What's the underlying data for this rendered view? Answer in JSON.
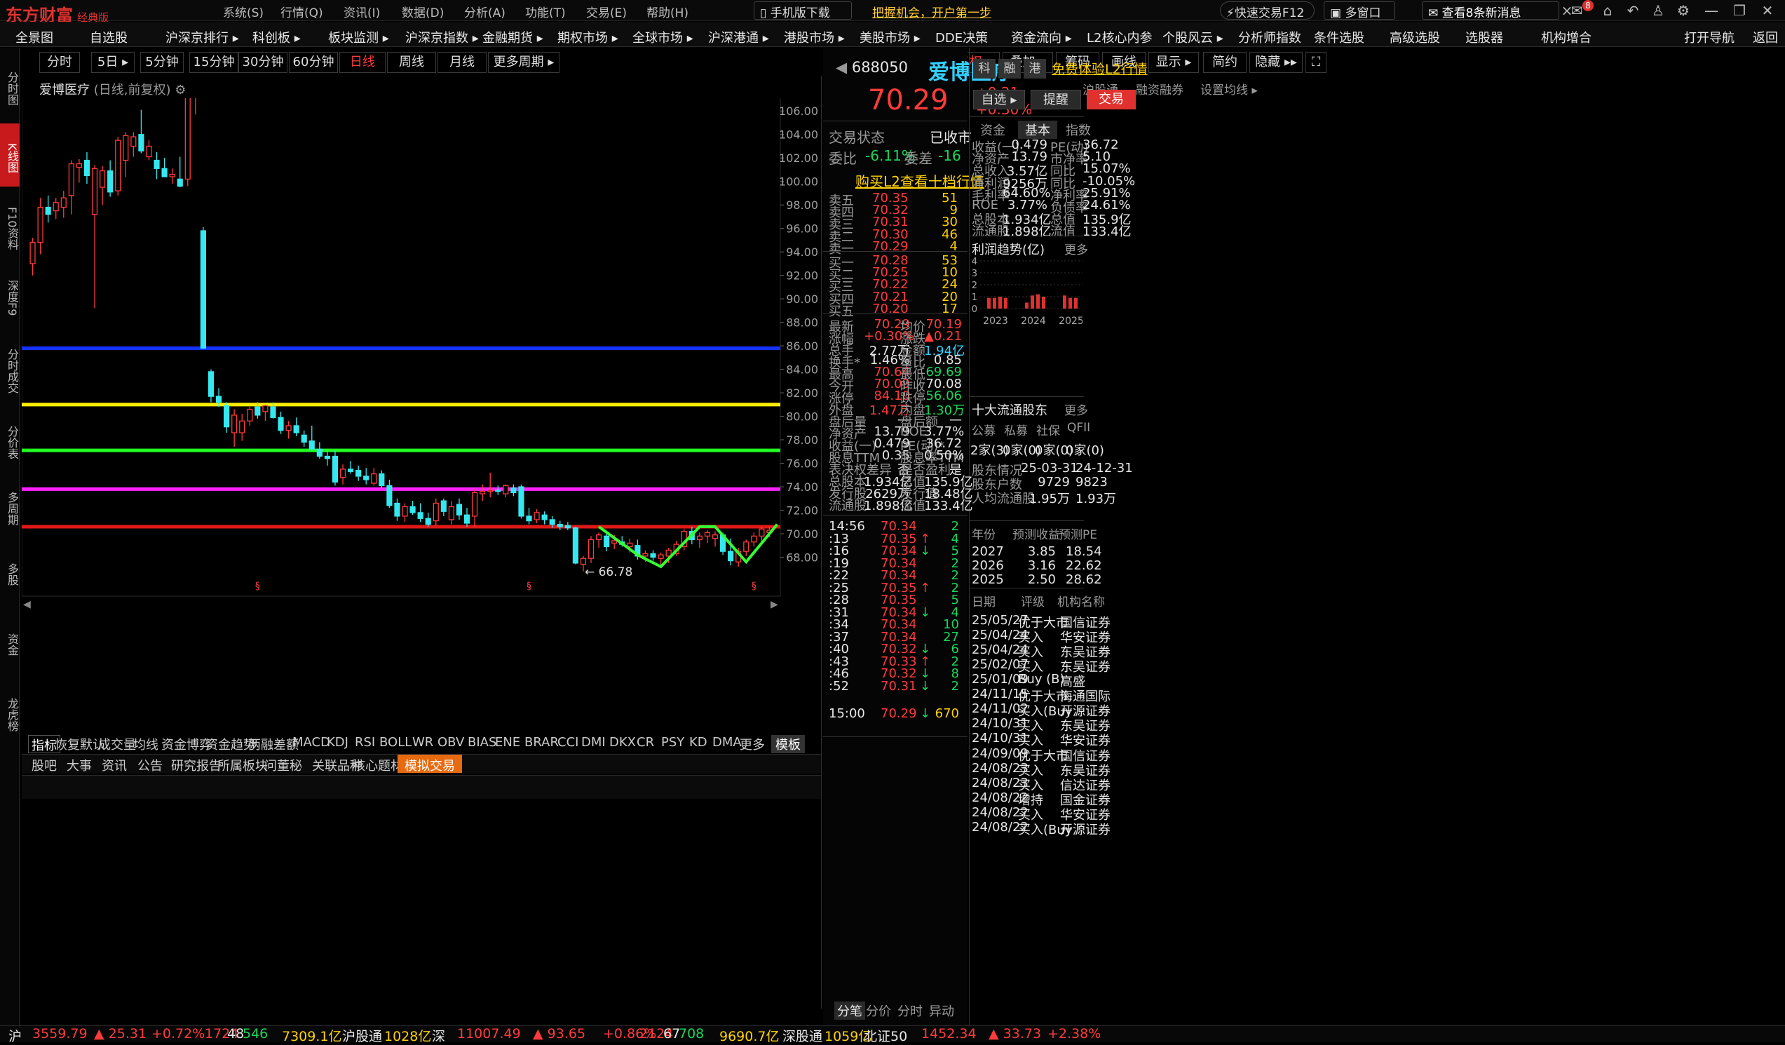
{
  "app": {
    "logo": "东方财富",
    "edition": "经典版"
  },
  "title_menu": [
    "系统(S)",
    "行情(Q)",
    "资讯(I)",
    "数据(D)",
    "分析(A)",
    "功能(T)",
    "交易(E)",
    "帮助(H)"
  ],
  "title_buttons": {
    "mobile": "手机版下载",
    "promo": "把握机会，开户第一步",
    "quick_trade": "快速交易F12",
    "multi_window": "多窗口",
    "messages": "查看8条新消息",
    "badge": "8"
  },
  "nav": [
    "全景图",
    "自选股",
    "沪深京排行 ▸",
    "科创板 ▸",
    "板块监测 ▸",
    "沪深京指数 ▸",
    "金融期货 ▸",
    "期权市场 ▸",
    "全球市场 ▸",
    "沪深港通 ▸",
    "港股市场 ▸",
    "美股市场 ▸",
    "DDE决策",
    "资金流向 ▸",
    "L2核心内参",
    "个股风云 ▸",
    "分析师指数",
    "条件选股",
    "高级选股",
    "选股器",
    "机构增合",
    "打开导航",
    "返回"
  ],
  "left_tabs": [
    "分时图",
    "K线图",
    "F10资料",
    "深度F9",
    "分时成交",
    "分价表",
    "多周期",
    "多股",
    "资金",
    "龙虎榜"
  ],
  "periods": [
    "分时",
    "5日 ▸",
    "5分钟",
    "15分钟",
    "30分钟",
    "60分钟",
    "日线",
    "周线",
    "月线",
    "更多周期 ▸"
  ],
  "chart_tools": [
    "+",
    "−",
    "复权 ▸",
    "叠加 ▸",
    "筹码",
    "画线",
    "显示 ▸",
    "简约",
    "隐藏 ▸▸"
  ],
  "chart_header": {
    "name": "爱博医疗",
    "mode": "(日线,前复权)",
    "links": [
      "沪股通",
      "融资融券",
      "设置均线 ▸"
    ]
  },
  "chart_data": {
    "type": "candlestick",
    "ylim": [
      66.0,
      109.0
    ],
    "yticks": [
      "108.00",
      "106.00",
      "104.00",
      "102.00",
      "100.00",
      "98.00",
      "96.00",
      "94.00",
      "92.00",
      "90.00",
      "88.00",
      "86.00",
      "84.00",
      "82.00",
      "80.00",
      "78.00",
      "76.00",
      "74.00",
      "72.00",
      "70.00",
      "68.00"
    ],
    "high_label": "108.09",
    "low_label": "66.78",
    "hlines": [
      {
        "value": 85.8,
        "color": "#1632ff"
      },
      {
        "value": 81.0,
        "color": "#ffee00"
      },
      {
        "value": 77.1,
        "color": "#22ff22"
      },
      {
        "value": 73.8,
        "color": "#ff22ff"
      },
      {
        "value": 70.6,
        "color": "#e01818"
      }
    ],
    "candles": [
      [
        93.0,
        95.2,
        92.0,
        94.8
      ],
      [
        94.8,
        98.6,
        93.8,
        97.8
      ],
      [
        97.8,
        98.8,
        96.5,
        97.2
      ],
      [
        97.5,
        98.6,
        96.8,
        98.2
      ],
      [
        97.8,
        99.2,
        96.9,
        98.6
      ],
      [
        98.8,
        101.8,
        97.2,
        101.5
      ],
      [
        101.2,
        101.9,
        99.9,
        101.5
      ],
      [
        101.8,
        102.5,
        99.8,
        100.5
      ],
      [
        97.2,
        101.4,
        89.2,
        101.1
      ],
      [
        99.5,
        101.3,
        98.0,
        100.9
      ],
      [
        100.9,
        101.8,
        98.7,
        99.1
      ],
      [
        99.2,
        103.8,
        98.8,
        103.5
      ],
      [
        101.8,
        104.2,
        100.4,
        103.9
      ],
      [
        103.0,
        104.2,
        102.1,
        103.8
      ],
      [
        104.0,
        106.1,
        102.4,
        102.6
      ],
      [
        102.1,
        103.5,
        101.8,
        103.0
      ],
      [
        101.8,
        102.5,
        100.2,
        101.1
      ],
      [
        101.1,
        102.0,
        100.6,
        100.4
      ],
      [
        100.4,
        101.1,
        99.8,
        100.6
      ],
      [
        100.2,
        102.1,
        99.5,
        99.6
      ],
      [
        100.2,
        108.1,
        99.6,
        107.6
      ],
      [
        107.2,
        107.8,
        105.7,
        107.5
      ],
      [
        95.8,
        96.1,
        85.8,
        85.8
      ],
      [
        83.8,
        84.0,
        81.2,
        81.7
      ],
      [
        81.7,
        82.4,
        80.8,
        81.2
      ],
      [
        80.9,
        81.2,
        78.6,
        79.1
      ],
      [
        78.6,
        80.6,
        77.4,
        80.1
      ],
      [
        78.6,
        80.2,
        77.9,
        79.6
      ],
      [
        79.6,
        80.9,
        79.2,
        80.6
      ],
      [
        80.8,
        81.2,
        79.8,
        80.1
      ],
      [
        80.4,
        81.0,
        79.6,
        80.9
      ],
      [
        80.8,
        81.2,
        79.8,
        79.9
      ],
      [
        79.9,
        80.4,
        78.5,
        78.8
      ],
      [
        78.8,
        79.6,
        78.1,
        79.2
      ],
      [
        79.2,
        79.9,
        78.3,
        78.6
      ],
      [
        78.4,
        78.8,
        77.4,
        77.8
      ],
      [
        77.9,
        79.2,
        77.3,
        77.2
      ],
      [
        77.2,
        77.8,
        76.4,
        76.6
      ],
      [
        76.6,
        77.2,
        75.8,
        76.4
      ],
      [
        76.6,
        77.1,
        74.1,
        74.4
      ],
      [
        74.8,
        75.9,
        74.2,
        75.5
      ],
      [
        75.5,
        76.2,
        75.1,
        75.3
      ],
      [
        75.4,
        75.8,
        74.5,
        74.9
      ],
      [
        74.9,
        75.6,
        74.2,
        74.6
      ],
      [
        74.3,
        75.6,
        74.1,
        75.1
      ],
      [
        75.1,
        75.4,
        73.9,
        74.1
      ],
      [
        74.1,
        74.6,
        72.2,
        72.4
      ],
      [
        72.6,
        73.0,
        71.1,
        71.5
      ],
      [
        71.5,
        72.6,
        71.0,
        72.3
      ],
      [
        72.3,
        72.8,
        71.6,
        71.8
      ],
      [
        71.8,
        72.6,
        71.0,
        71.3
      ],
      [
        71.3,
        71.8,
        70.6,
        70.8
      ],
      [
        71.1,
        73.0,
        70.7,
        72.6
      ],
      [
        72.8,
        73.0,
        71.5,
        71.9
      ],
      [
        71.2,
        72.8,
        70.8,
        72.3
      ],
      [
        72.5,
        73.0,
        71.2,
        71.6
      ],
      [
        71.6,
        72.2,
        70.6,
        70.9
      ],
      [
        71.5,
        73.8,
        70.6,
        73.5
      ],
      [
        73.4,
        74.2,
        72.8,
        73.6
      ],
      [
        73.6,
        75.2,
        73.1,
        73.7
      ],
      [
        73.7,
        74.1,
        73.3,
        73.6
      ],
      [
        73.4,
        74.2,
        73.1,
        74.1
      ],
      [
        73.9,
        74.2,
        73.2,
        73.5
      ],
      [
        74.0,
        74.2,
        71.3,
        71.5
      ],
      [
        71.5,
        72.2,
        70.8,
        71.1
      ],
      [
        71.2,
        72.1,
        70.9,
        71.8
      ],
      [
        71.6,
        71.9,
        70.8,
        71.2
      ],
      [
        71.2,
        71.5,
        70.5,
        70.8
      ],
      [
        70.8,
        71.1,
        70.3,
        70.6
      ],
      [
        70.7,
        71.0,
        70.3,
        70.5
      ],
      [
        70.5,
        70.6,
        67.4,
        67.5
      ],
      [
        67.4,
        68.1,
        66.8,
        67.9
      ],
      [
        67.9,
        69.8,
        67.5,
        69.5
      ],
      [
        69.5,
        70.1,
        68.8,
        69.9
      ],
      [
        69.8,
        70.1,
        68.5,
        68.9
      ],
      [
        69.2,
        69.9,
        68.7,
        69.4
      ],
      [
        69.3,
        69.8,
        68.9,
        69.1
      ],
      [
        68.9,
        69.6,
        68.4,
        69.2
      ],
      [
        69.0,
        69.5,
        67.8,
        68.1
      ],
      [
        68.1,
        68.6,
        67.6,
        68.3
      ],
      [
        68.3,
        68.6,
        67.7,
        68.0
      ],
      [
        67.9,
        68.4,
        67.2,
        68.2
      ],
      [
        68.1,
        68.8,
        67.5,
        68.6
      ],
      [
        68.3,
        69.4,
        68.1,
        69.1
      ],
      [
        68.9,
        70.4,
        68.6,
        70.2
      ],
      [
        70.2,
        70.6,
        69.1,
        69.5
      ],
      [
        69.5,
        70.1,
        68.8,
        69.8
      ],
      [
        69.8,
        70.3,
        69.2,
        70.1
      ],
      [
        69.6,
        70.2,
        68.9,
        69.9
      ],
      [
        69.9,
        70.1,
        68.2,
        68.5
      ],
      [
        68.5,
        69.6,
        67.3,
        67.7
      ],
      [
        67.6,
        68.8,
        67.2,
        68.5
      ],
      [
        68.5,
        69.5,
        68.1,
        69.3
      ],
      [
        69.3,
        70.1,
        68.9,
        69.8
      ],
      [
        69.8,
        70.6,
        69.3,
        70.4
      ],
      [
        70.1,
        70.6,
        69.7,
        70.3
      ]
    ],
    "pattern": [
      [
        73,
        70.6
      ],
      [
        78,
        68.2
      ],
      [
        81,
        67.2
      ],
      [
        86,
        70.6
      ],
      [
        88,
        70.6
      ],
      [
        92,
        67.6
      ],
      [
        96,
        70.8
      ]
    ],
    "stars": [
      11,
      15,
      16,
      18,
      22,
      27,
      33,
      43,
      45,
      51,
      57,
      62,
      71,
      73
    ],
    "s_marks": [
      29,
      64,
      93
    ]
  },
  "ind_tabs": [
    "指标",
    "恢复默认",
    "成交量",
    "均线",
    "资金博弈",
    "资金趋势",
    "两融差额",
    "MACD",
    "KDJ",
    "RSI",
    "BOLL",
    "WR",
    "OBV",
    "BIAS",
    "ENE",
    "BRAR",
    "CCI",
    "DMI",
    "DKX",
    "CR",
    "PSY",
    "KD",
    "DMA",
    "更多",
    "模板"
  ],
  "bottom_tabs": [
    "股吧",
    "大事",
    "资讯",
    "公告",
    "研究报告",
    "所属板块",
    "问董秘",
    "关联品种",
    "核心题材",
    "模拟交易"
  ],
  "quote": {
    "code": "688050",
    "name": "爱博医疗",
    "price": "70.29",
    "change": "+0.21",
    "pct": "+0.30%",
    "tags": [
      "科",
      "融",
      "港"
    ],
    "l2_trial": "免费体验L2行情",
    "btn_watch": "自选 ▸",
    "btn_alert": "提醒",
    "btn_trade": "交易",
    "trade_state_label": "交易状态",
    "trade_state": "已收市",
    "wb_label": "委比",
    "wb": "-6.11%",
    "wc_label": "委差",
    "wc": "-16",
    "l2_buy": "购买L2查看十档行情",
    "asks": [
      [
        "卖五",
        "70.35",
        "51"
      ],
      [
        "卖四",
        "70.32",
        "9"
      ],
      [
        "卖三",
        "70.31",
        "30"
      ],
      [
        "卖二",
        "70.30",
        "46"
      ],
      [
        "卖一",
        "70.29",
        "4"
      ]
    ],
    "bids": [
      [
        "买一",
        "70.28",
        "53"
      ],
      [
        "买二",
        "70.25",
        "10"
      ],
      [
        "买三",
        "70.22",
        "24"
      ],
      [
        "买四",
        "70.21",
        "20"
      ],
      [
        "买五",
        "70.20",
        "17"
      ]
    ],
    "stats": [
      [
        "最新",
        "70.29",
        "均价",
        "70.19"
      ],
      [
        "涨幅",
        "+0.30%",
        "涨跌",
        "▲0.21"
      ],
      [
        "总手",
        "2.77万",
        "金额",
        "1.94亿"
      ],
      [
        "换手*",
        "1.46%",
        "量比",
        "0.85"
      ],
      [
        "最高",
        "70.64",
        "最低",
        "69.69"
      ],
      [
        "今开",
        "70.09",
        "昨收",
        "70.08"
      ],
      [
        "涨停",
        "84.10",
        "跌停",
        "56.06"
      ],
      [
        "外盘",
        "1.47万",
        "内盘",
        "1.30万"
      ],
      [
        "盘后量",
        "—",
        "盘后额",
        "—"
      ],
      [
        "净资产",
        "13.79",
        "ROE",
        "3.77%"
      ],
      [
        "收益(一)",
        "0.479",
        "PE(动)*",
        "36.72"
      ],
      [
        "股息TTM",
        "0.35",
        "股息率TTM",
        "0.50%"
      ],
      [
        "表决权差异",
        "否",
        "是否盈利",
        "是"
      ],
      [
        "总股本",
        "1.934亿",
        "总值",
        "135.9亿"
      ],
      [
        "发行股",
        "2629万",
        "发行值",
        "18.48亿"
      ],
      [
        "流通股",
        "1.898亿",
        "流值",
        "133.4亿"
      ]
    ],
    "ticks": [
      [
        "14:56",
        "70.34",
        "2"
      ],
      [
        ":13",
        "70.35",
        "4"
      ],
      [
        ":16",
        "70.34",
        "5"
      ],
      [
        ":19",
        "70.34",
        "2"
      ],
      [
        ":22",
        "70.34",
        "2"
      ],
      [
        ":25",
        "70.35",
        "2"
      ],
      [
        ":28",
        "70.35",
        "5"
      ],
      [
        ":31",
        "70.34",
        "4"
      ],
      [
        ":34",
        "70.34",
        "10"
      ],
      [
        ":37",
        "70.34",
        "27"
      ],
      [
        ":40",
        "70.32",
        "6"
      ],
      [
        ":43",
        "70.33",
        "2"
      ],
      [
        ":46",
        "70.32",
        "8"
      ],
      [
        ":52",
        "70.31",
        "2"
      ],
      [
        "15:00",
        "70.29",
        "670"
      ]
    ],
    "tick_tabs": [
      "分笔",
      "分价",
      "分时",
      "异动"
    ]
  },
  "fund": {
    "tabs": [
      "资金",
      "基本",
      "指数"
    ],
    "rows": [
      [
        "收益(一)",
        "0.479",
        "PE(动)",
        "36.72"
      ],
      [
        "净资产",
        "13.79",
        "市净率",
        "5.10"
      ],
      [
        "总收入",
        "3.57亿",
        "同比",
        "15.07%"
      ],
      [
        "净利润",
        "9256万",
        "同比",
        "-10.05%"
      ],
      [
        "毛利率",
        "64.60%",
        "净利率",
        "25.91%"
      ],
      [
        "ROE",
        "3.77%",
        "负债率",
        "24.61%"
      ],
      [
        "总股本",
        "1.934亿",
        "总值",
        "135.9亿"
      ],
      [
        "流通股",
        "1.898亿",
        "流值",
        "133.4亿"
      ]
    ],
    "profit_title": "利润趋势(亿)",
    "more": "更多",
    "profit_ticks": [
      "4",
      "3",
      "2",
      "1",
      "0"
    ],
    "profit_years": [
      "2023",
      "2024",
      "2025"
    ],
    "profit_bars": [
      0.9,
      0.9,
      1.0,
      0.9,
      0.5,
      1.1,
      1.2,
      1.0,
      1.1,
      0.9,
      0.9
    ],
    "holders_title": "十大流通股东",
    "holder_cols": [
      "公募",
      "私募",
      "社保",
      "QFII"
    ],
    "holder_vals": [
      "2家(3)",
      "0家(0)",
      "0家(0)",
      "0家(0)"
    ],
    "holder_rows": [
      [
        "股东情况",
        "25-03-31",
        "24-12-31"
      ],
      [
        "股东户数",
        "9729",
        "9823"
      ],
      [
        "人均流通股",
        "1.95万",
        "1.93万"
      ]
    ],
    "forecast_head": [
      "年份",
      "预测收益",
      "预测PE"
    ],
    "forecast": [
      [
        "2027",
        "3.85",
        "18.54"
      ],
      [
        "2026",
        "3.16",
        "22.62"
      ],
      [
        "2025",
        "2.50",
        "28.62"
      ]
    ],
    "rating_head": [
      "日期",
      "评级",
      "机构名称"
    ],
    "ratings": [
      [
        "25/05/27",
        "优于大市",
        "国信证券"
      ],
      [
        "25/04/24",
        "买入",
        "华安证券"
      ],
      [
        "25/04/24",
        "买入",
        "东吴证券"
      ],
      [
        "25/02/07",
        "买入",
        "东吴证券"
      ],
      [
        "25/01/09",
        "Buy (B)",
        "高盛"
      ],
      [
        "24/11/15",
        "优于大市",
        "海通国际"
      ],
      [
        "24/11/02",
        "买入(Buy",
        "开源证券"
      ],
      [
        "24/10/31",
        "买入",
        "东吴证券"
      ],
      [
        "24/10/31",
        "买入",
        "华安证券"
      ],
      [
        "24/09/09",
        "优于大市",
        "国信证券"
      ],
      [
        "24/08/23",
        "买入",
        "东吴证券"
      ],
      [
        "24/08/23",
        "买入",
        "信达证券"
      ],
      [
        "24/08/22",
        "增持",
        "国金证券"
      ],
      [
        "24/08/22",
        "买入",
        "华安证券"
      ],
      [
        "24/08/22",
        "买入(Buy",
        "开源证券"
      ]
    ]
  },
  "status": {
    "sh_label": "沪",
    "sh": "3559.79",
    "sh_chg": "▲ 25.31",
    "sh_pct": "+0.72%",
    "sh_up": "1724",
    "sh_flat": "48",
    "sh_dn": "546",
    "sh_amt": "7309.1亿",
    "hgt_label": "沪股通",
    "hgt": "1028亿",
    "sz_label": "深",
    "sz": "11007.49",
    "sz_chg": "▲ 93.65",
    "sz_pct": "+0.86%",
    "sz_up": "2124",
    "sz_flat": "67",
    "sz_dn": "708",
    "sz_amt": "9690.7亿",
    "sgt_label": "深股通",
    "sgt": "1059亿",
    "bz_label": "北证50",
    "bz": "1452.34",
    "bz_chg": "▲ 33.73",
    "bz_pct": "+2.38%"
  }
}
